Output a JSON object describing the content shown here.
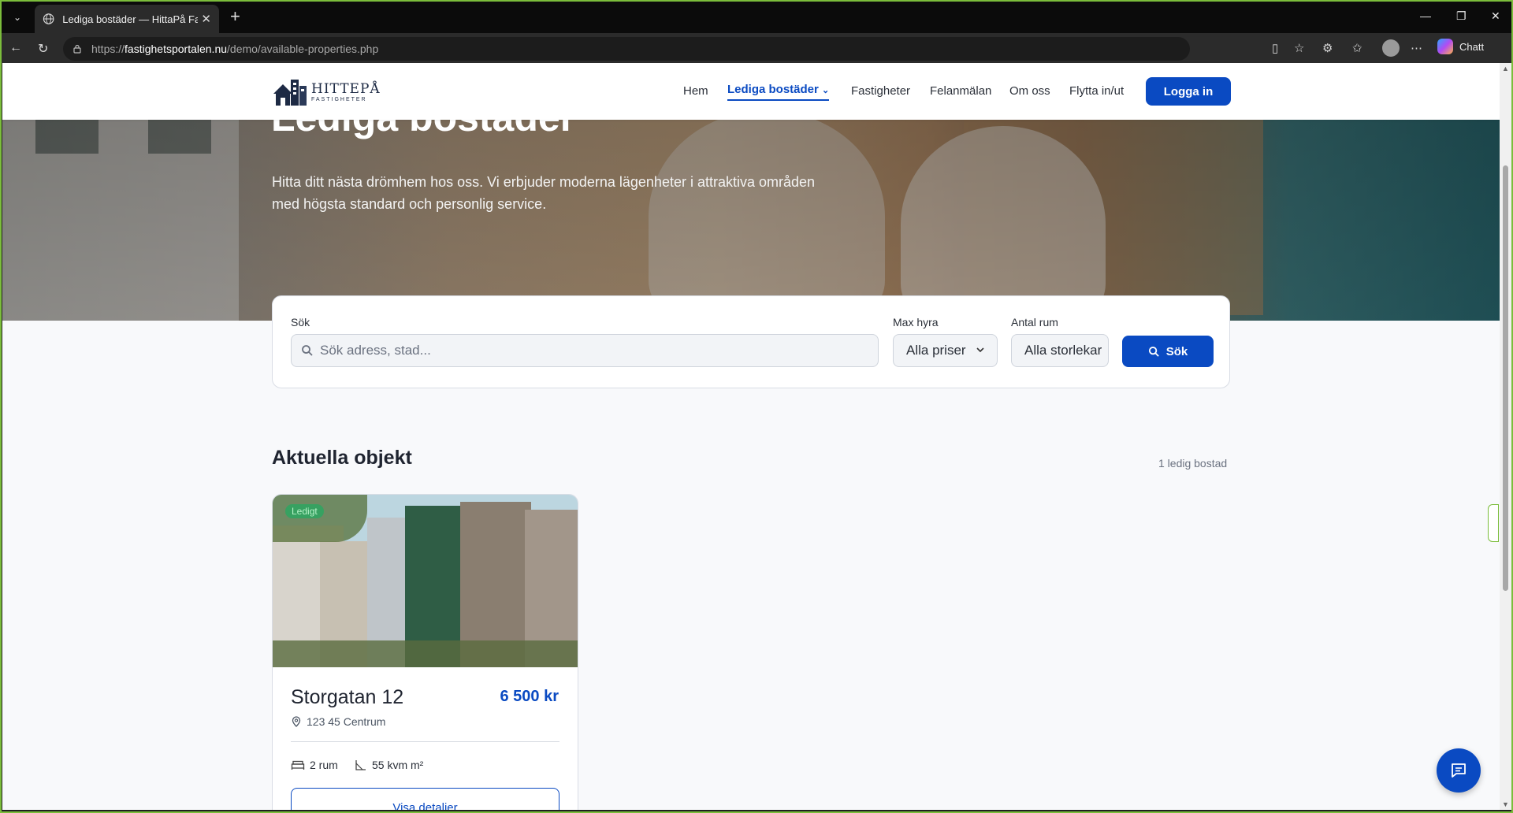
{
  "browser": {
    "tab_title": "Lediga bostäder — HittaPå Fastigheter",
    "url_prefix": "https://",
    "url_domain": "fastighetsportalen.nu",
    "url_path": "/demo/available-properties.php",
    "copilot_label": "Chatt"
  },
  "header": {
    "brand_name": "HITTEPÅ",
    "brand_sub": "FASTIGHETER",
    "nav": [
      "Hem",
      "Lediga bostäder",
      "Fastigheter",
      "Felanmälan",
      "Om oss",
      "Flytta in/ut"
    ],
    "login_label": "Logga in"
  },
  "hero": {
    "title": "Lediga bostäder",
    "subtitle": "Hitta ditt nästa drömhem hos oss. Vi erbjuder moderna lägenheter i attraktiva områden med högsta standard och personlig service."
  },
  "search": {
    "search_label": "Sök",
    "search_placeholder": "Sök adress, stad...",
    "rent_label": "Max hyra",
    "rent_value": "Alla priser",
    "rooms_label": "Antal rum",
    "rooms_value": "Alla storlekar",
    "button_label": "Sök"
  },
  "listing": {
    "section_title": "Aktuella objekt",
    "count_text": "1 ledig bostad",
    "cards": [
      {
        "badge": "Ledigt",
        "title": "Storgatan 12",
        "price": "6 500 kr",
        "address": "123 45 Centrum",
        "rooms": "2 rum",
        "area": "55 kvm m²",
        "details_label": "Visa detaljer"
      }
    ]
  },
  "colors": {
    "accent": "#0a4ac2",
    "frame_border": "#7bbd3b"
  }
}
